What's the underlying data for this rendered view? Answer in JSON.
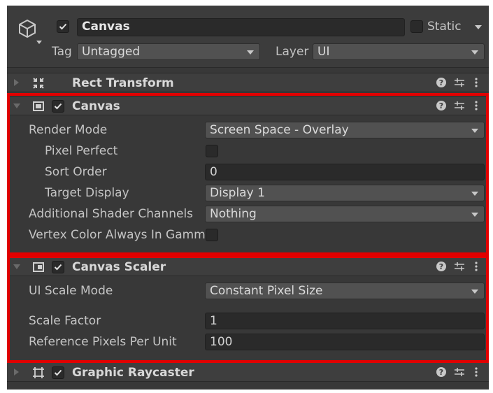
{
  "gameobject": {
    "name": "Canvas",
    "static_label": "Static",
    "tag_label": "Tag",
    "tag_value": "Untagged",
    "layer_label": "Layer",
    "layer_value": "UI"
  },
  "components": {
    "rect_transform": {
      "title": "Rect Transform",
      "expanded": false
    },
    "canvas": {
      "title": "Canvas",
      "enabled": true,
      "render_mode_label": "Render Mode",
      "render_mode_value": "Screen Space - Overlay",
      "pixel_perfect_label": "Pixel Perfect",
      "pixel_perfect_checked": false,
      "sort_order_label": "Sort Order",
      "sort_order_value": "0",
      "target_display_label": "Target Display",
      "target_display_value": "Display 1",
      "shader_channels_label": "Additional Shader Channels",
      "shader_channels_value": "Nothing",
      "vertex_color_label": "Vertex Color Always In Gamm",
      "vertex_color_checked": false
    },
    "canvas_scaler": {
      "title": "Canvas Scaler",
      "enabled": true,
      "ui_scale_mode_label": "UI Scale Mode",
      "ui_scale_mode_value": "Constant Pixel Size",
      "scale_factor_label": "Scale Factor",
      "scale_factor_value": "1",
      "ref_pixels_label": "Reference Pixels Per Unit",
      "ref_pixels_value": "100"
    },
    "graphic_raycaster": {
      "title": "Graphic Raycaster",
      "enabled": true,
      "expanded": false
    }
  },
  "header_icons": [
    "help-icon",
    "presets-icon",
    "more-menu-icon"
  ],
  "colors": {
    "panel_bg": "#383838",
    "header_bg": "#3e3e3e",
    "field_bg": "#2a2a2a",
    "dropdown_bg": "#515151",
    "highlight": "#e10000"
  }
}
